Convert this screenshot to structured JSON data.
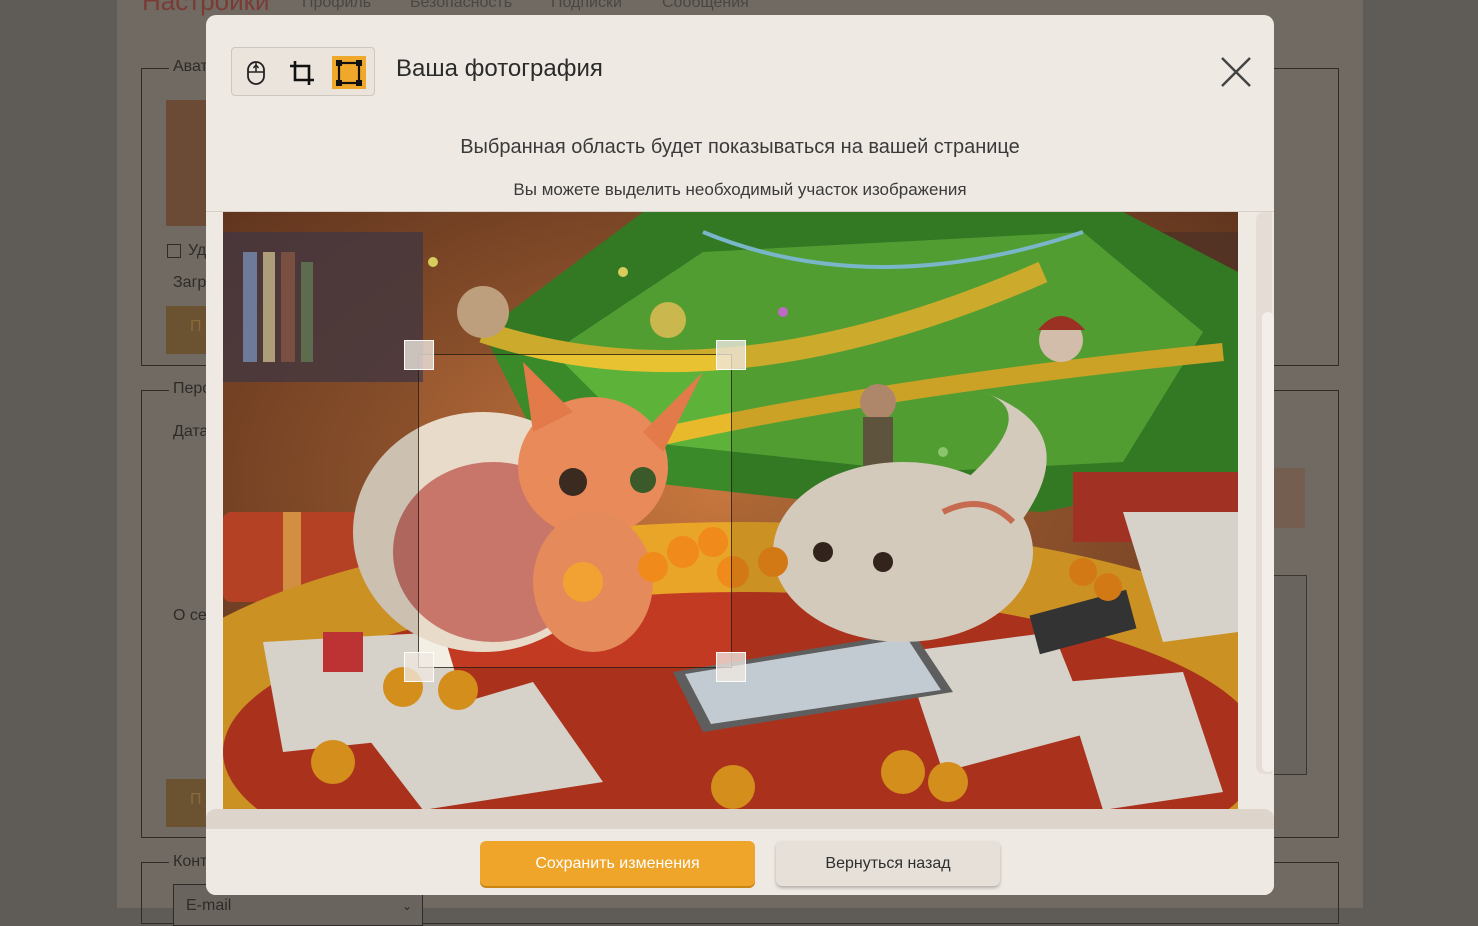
{
  "background": {
    "page_title": "Настройки",
    "nav": [
      "Профиль",
      "Безопасность",
      "Подписки",
      "Сообщения"
    ],
    "legends": [
      "Авата",
      "Перс",
      "Конт"
    ],
    "labels": [
      "Уд",
      "Загр",
      "Дата",
      "О се"
    ],
    "button_fragment": "П",
    "email_placeholder": "E-mail"
  },
  "modal": {
    "title": "Ваша фотография",
    "subtitle": "Выбранная область будет показываться на вашей странице",
    "hint": "Вы можете выделить необходимый участок изображения",
    "tools": [
      {
        "icon": "mouse-icon",
        "active": false
      },
      {
        "icon": "crop-icon",
        "active": false
      },
      {
        "icon": "select-area-icon",
        "active": true
      }
    ],
    "accent_color": "#f0a82a",
    "save_label": "Сохранить изменения",
    "back_label": "Вернуться назад"
  }
}
